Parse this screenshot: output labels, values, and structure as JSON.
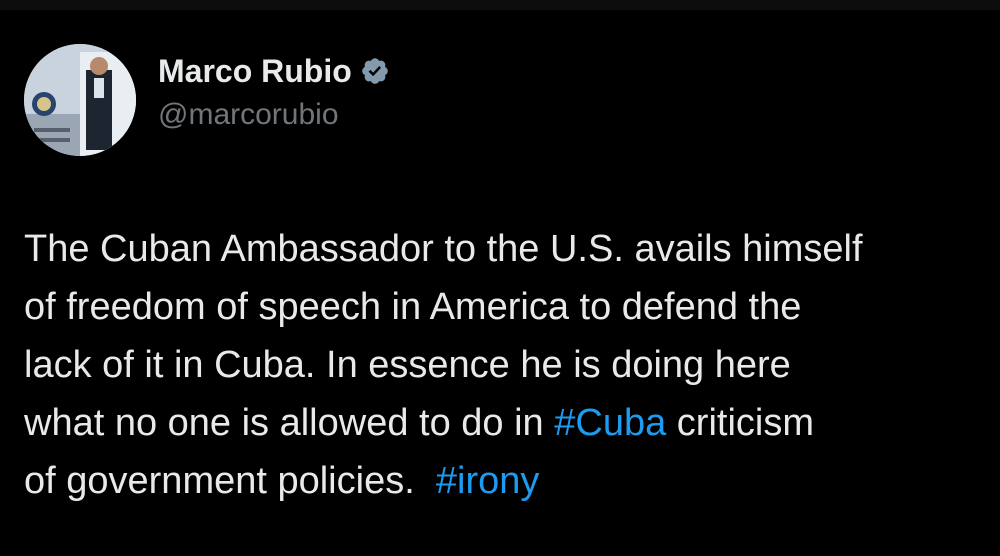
{
  "author": {
    "display_name": "Marco Rubio",
    "handle": "@marcorubio",
    "verified": true,
    "verified_icon": "verified-badge-icon",
    "avatar_icon": "profile-photo"
  },
  "tweet": {
    "lines": [
      {
        "text": "The Cuban Ambassador to the U.S. avails himself"
      },
      {
        "text": "of freedom of speech in America to defend the"
      },
      {
        "text": "lack of it in Cuba. In essence he is doing here"
      },
      {
        "before": "what no one is allowed to do in ",
        "hashtag": "#Cuba",
        "after": " criticism"
      },
      {
        "before": "of government policies.  ",
        "hashtag": "#irony",
        "after": ""
      }
    ]
  },
  "colors": {
    "background": "#000000",
    "text": "#e7e9ea",
    "secondary_text": "#71767b",
    "hashtag": "#1d9bf0",
    "verified": "#829aab"
  }
}
